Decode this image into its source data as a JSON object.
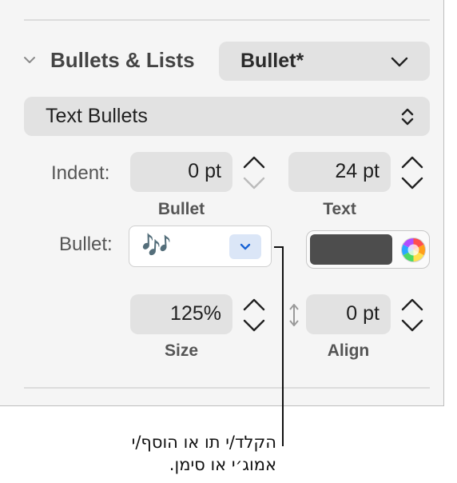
{
  "section": {
    "title": "Bullets & Lists",
    "list_style": "Bullet*",
    "bullet_type": "Text Bullets"
  },
  "indent": {
    "label": "Indent:",
    "bullet_value": "0 pt",
    "bullet_label": "Bullet",
    "text_value": "24 pt",
    "text_label": "Text"
  },
  "bullet": {
    "label": "Bullet:",
    "glyph": "🎶",
    "color": "#4d4d4d"
  },
  "size": {
    "value": "125%",
    "label": "Size"
  },
  "align": {
    "value": "0 pt",
    "label": "Align"
  },
  "callout": {
    "line1": "הקלד/י תו או הוסף/י",
    "line2": "אמוג׳י או סימן."
  },
  "icons": [
    "chevron-down-icon",
    "disclosure-icon",
    "up-down-arrows-icon",
    "stepper-icon",
    "color-wheel-icon",
    "vertical-arrows-icon"
  ]
}
